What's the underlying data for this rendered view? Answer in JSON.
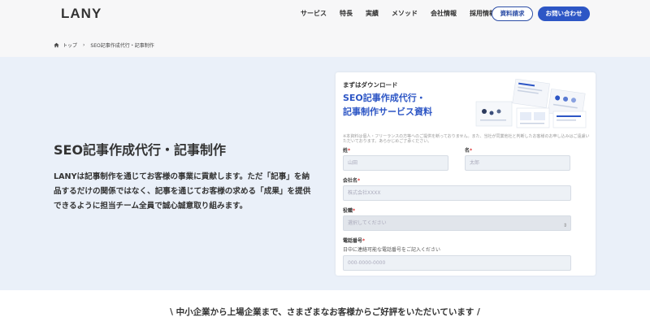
{
  "header": {
    "logo": "LANY",
    "nav": [
      "サービス",
      "特長",
      "実績",
      "メソッド",
      "会社情報",
      "採用情報"
    ],
    "doc_button": "資料請求",
    "contact_button": "お問い合わせ"
  },
  "breadcrumb": {
    "home": "トップ",
    "separator": "›",
    "current": "SEO記事作成代行・記事制作"
  },
  "main": {
    "title": "SEO記事作成代行・記事制作",
    "lead": "LANYは記事制作を通じてお客様の事業に貢献します。ただ「記事」を納品するだけの関係ではなく、記事を通じてお客様の求める「成果」を提供できるように担当チーム全員で誠心誠意取り組みます。"
  },
  "form": {
    "subtitle": "まずはダウンロード",
    "title_line1": "SEO記事作成代行・",
    "title_line2": "記事制作サービス資料",
    "note": "※本資料は個人・フリーランスの方等へのご提供を断っておりません。また、当社が同業他社と判断したお客様のお申し込みはご遠慮いただいております。あらかじめご了承ください。",
    "last_name_label": "姓",
    "last_name_placeholder": "山田",
    "first_name_label": "名",
    "first_name_placeholder": "太郎",
    "company_label": "会社名",
    "company_placeholder": "株式会社XXXX",
    "position_label": "役職",
    "position_placeholder": "選択してください",
    "phone_label": "電話番号",
    "phone_hint": "日中に連絡可能な電話番号をご記入ください",
    "phone_placeholder": "000-0000-0000",
    "required_mark": "*"
  },
  "bottom": {
    "tagline": "\\ 中小企業から上場企業まで、さまざまなお客様からご好評をいただいています /"
  },
  "colors": {
    "accent": "#2d56c5",
    "band": "#eaf0f9"
  }
}
